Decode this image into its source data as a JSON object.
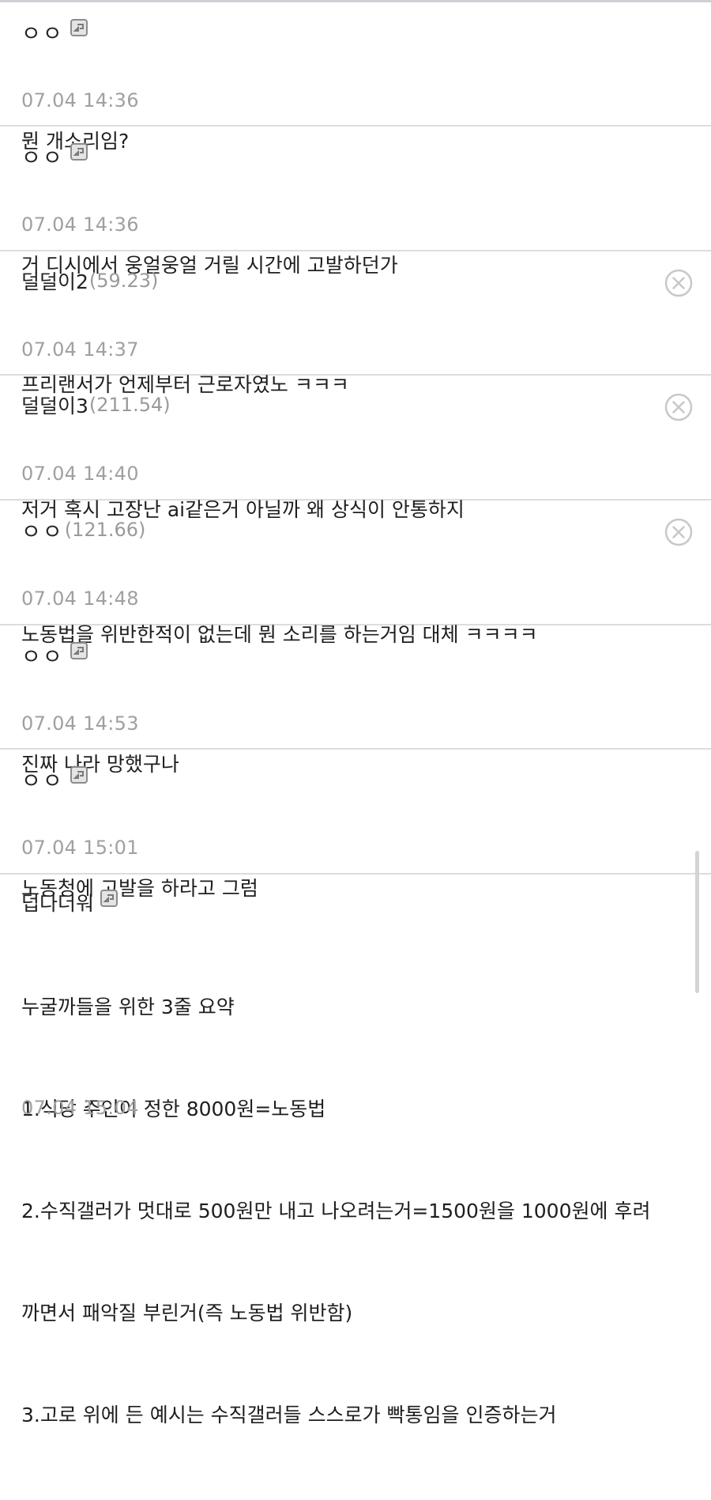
{
  "comments": [
    {
      "nick": "ㅇㅇ",
      "ip": "",
      "fixed": true,
      "deletable": false,
      "lines": [
        "뭔 개소리임?"
      ],
      "date": "07.04 14:36"
    },
    {
      "nick": "ㅇㅇ",
      "ip": "",
      "fixed": true,
      "deletable": false,
      "lines": [
        "거 디시에서 웅얼웅얼 거릴 시간에 고발하던가"
      ],
      "date": "07.04 14:36"
    },
    {
      "nick": "덜덜이2",
      "ip": "(59.23)",
      "fixed": false,
      "deletable": true,
      "lines": [
        "프리랜서가 언제부터 근로자였노 ㅋㅋㅋ"
      ],
      "date": "07.04 14:37"
    },
    {
      "nick": "덜덜이3",
      "ip": "(211.54)",
      "fixed": false,
      "deletable": true,
      "lines": [
        "저거 혹시 고장난 ai같은거 아닐까 왜 상식이 안통하지"
      ],
      "date": "07.04 14:40"
    },
    {
      "nick": "ㅇㅇ",
      "ip": "(121.66)",
      "fixed": false,
      "deletable": true,
      "lines": [
        "노동법을 위반한적이 없는데 뭔 소리를 하는거임 대체 ㅋㅋㅋㅋ"
      ],
      "date": "07.04 14:48"
    },
    {
      "nick": "ㅇㅇ",
      "ip": "",
      "fixed": true,
      "deletable": false,
      "lines": [
        "진짜 나라 망했구나"
      ],
      "date": "07.04 14:53"
    },
    {
      "nick": "ㅇㅇ",
      "ip": "",
      "fixed": true,
      "deletable": false,
      "lines": [
        "노동청에 고발을 하라고 그럼"
      ],
      "date": "07.04 15:01"
    },
    {
      "nick": "덥다더워",
      "ip": "",
      "fixed": true,
      "deletable": false,
      "lines": [
        "누굴까들을 위한 3줄 요약",
        "1.식당 주인이 정한 8000원=노동법",
        "2.수직갤러가 멋대로 500원만 내고 나오려는거=1500원을 1000원에 후려",
        "까면서 패악질 부린거(즉 노동법 위반함)",
        "3.고로 위에 든 예시는 수직갤러들 스스로가 빡통임을 인증하는거"
      ],
      "date": "07.04 15:04"
    }
  ],
  "icons": {
    "fixed_nick": "fixed-nickname-icon",
    "delete": "delete-circle-x-icon"
  },
  "colors": {
    "divider": "#dddddd",
    "meta_gray": "#a0a0a0",
    "ip_gray": "#9a9a9a",
    "delete_gray": "#c8c8c8"
  }
}
